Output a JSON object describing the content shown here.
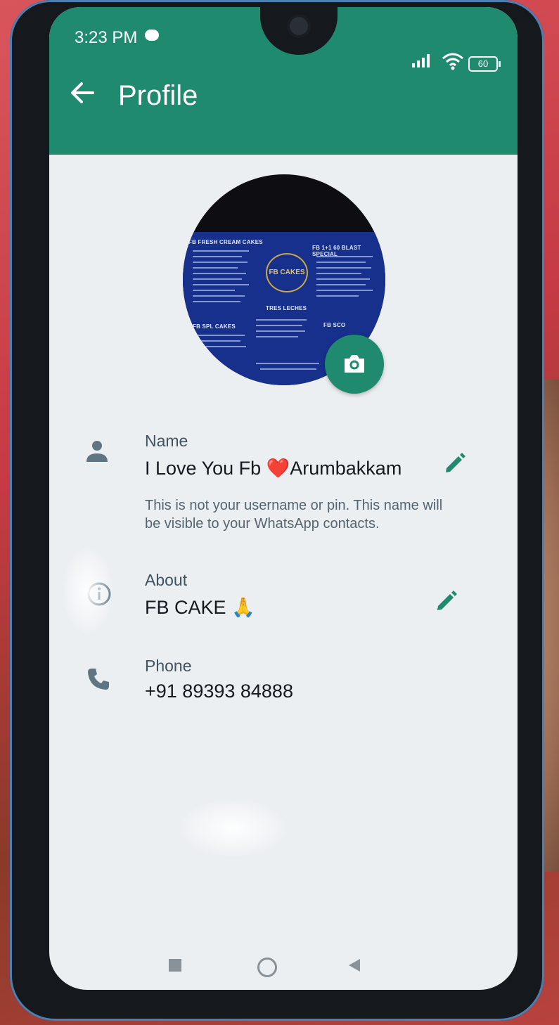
{
  "status_bar": {
    "time": "3:23 PM",
    "battery": "60"
  },
  "app_bar": {
    "title": "Profile"
  },
  "profile_photo": {
    "menu_headings": [
      "FB FRESH CREAM CAKES",
      "FB 1+1 60 BLAST SPECIAL",
      "FB SPL CAKES",
      "TRES LECHES",
      "FB SCO"
    ],
    "logo_text": "FB CAKES"
  },
  "name_section": {
    "label": "Name",
    "value": "I Love You Fb ❤️Arumbakkam",
    "hint": "This is not your username or pin. This name will be visible to your WhatsApp contacts."
  },
  "about_section": {
    "label": "About",
    "value": "FB CAKE 🙏"
  },
  "phone_section": {
    "label": "Phone",
    "value": "+91 89393 84888"
  },
  "colors": {
    "app_bar": "#1f8a6e",
    "icon": "#5f7582",
    "accent": "#1f8a6e"
  }
}
